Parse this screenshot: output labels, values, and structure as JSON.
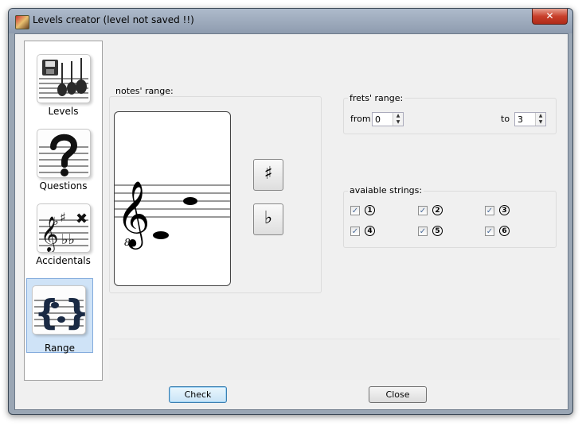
{
  "window": {
    "title": "Levels creator  (level not saved !!)",
    "close_glyph": "✕",
    "app_icon": "guitar-app-icon"
  },
  "sidebar": {
    "items": [
      {
        "label": "Levels",
        "icon": "levels-icon",
        "selected": false
      },
      {
        "label": "Questions",
        "icon": "question-icon",
        "selected": false
      },
      {
        "label": "Accidentals",
        "icon": "accidentals-icon",
        "selected": false
      },
      {
        "label": "Range",
        "icon": "range-icon",
        "selected": true
      }
    ]
  },
  "notes_range": {
    "label": "notes' range:",
    "clef_number": "8",
    "sharp_glyph": "♯",
    "flat_glyph": "♭"
  },
  "frets_range": {
    "label": "frets' range:",
    "from_label": "from",
    "from_value": "0",
    "to_label": "to",
    "to_value": "3"
  },
  "strings": {
    "label": "avaiable strings:",
    "items": [
      {
        "num": "1",
        "checked": true
      },
      {
        "num": "2",
        "checked": true
      },
      {
        "num": "3",
        "checked": true
      },
      {
        "num": "4",
        "checked": true
      },
      {
        "num": "5",
        "checked": true
      },
      {
        "num": "6",
        "checked": true
      }
    ]
  },
  "buttons": {
    "check": "Check",
    "close": "Close"
  },
  "colors": {
    "selected_bg": "#cfe3f7",
    "accent": "#3c7fb1"
  }
}
